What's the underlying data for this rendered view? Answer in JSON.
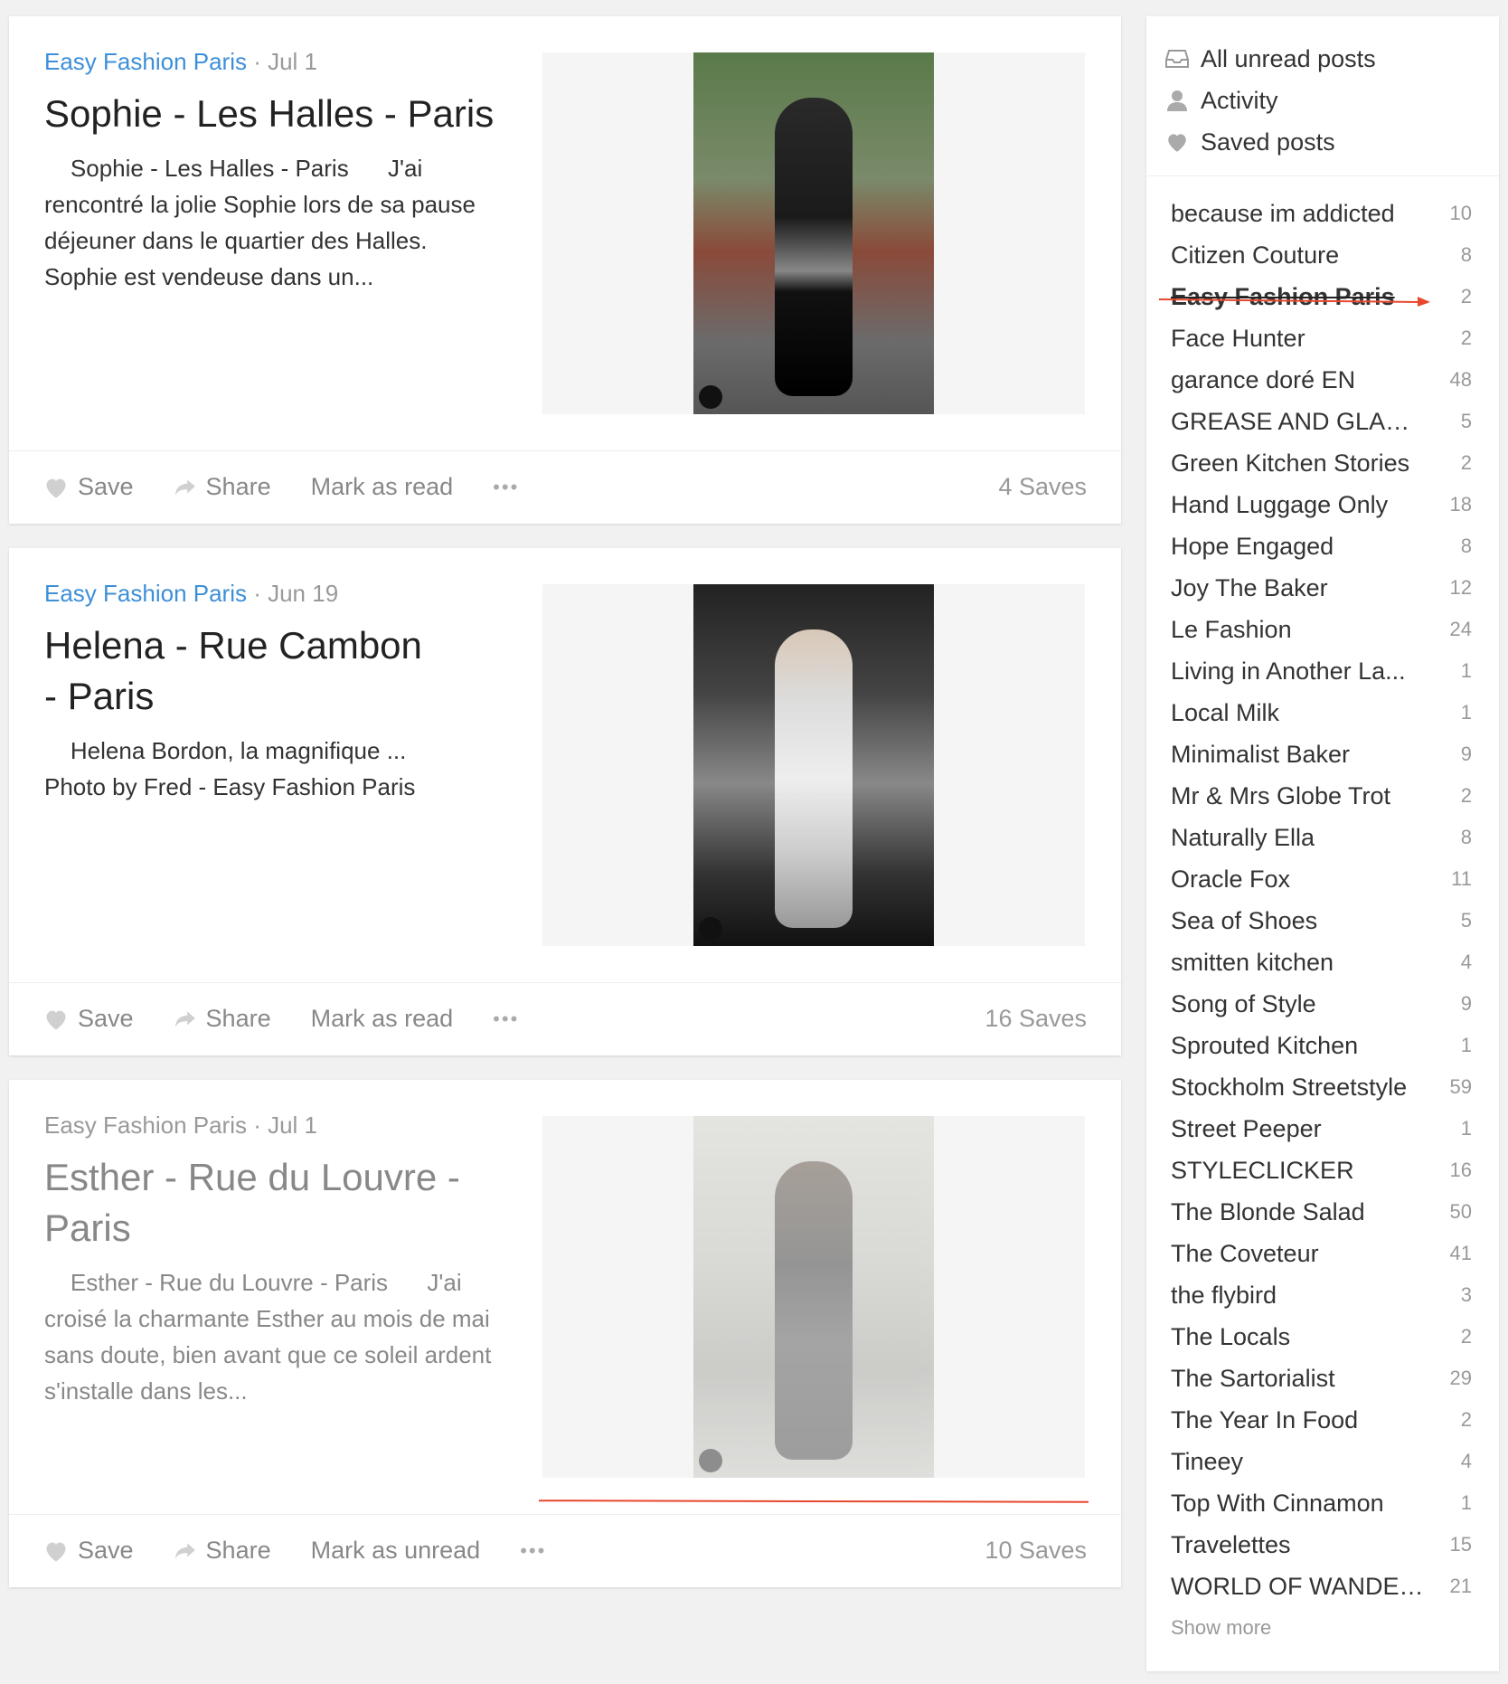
{
  "colors": {
    "accent": "#3d8fd8",
    "annotation": "#e8472e"
  },
  "posts": [
    {
      "source": "Easy Fashion Paris",
      "sep": " · ",
      "date": "Jul 1",
      "title": "Sophie - Les Halles - Paris",
      "excerpt": "    Sophie - Les Halles - Paris      J'ai rencontré la jolie Sophie lors de sa pause déjeuner dans le quartier des Halles.     Sophie est vendeuse dans un...",
      "save_label": "Save",
      "share_label": "Share",
      "mark_label": "Mark as read",
      "more_label": "•••",
      "saves": "4 Saves",
      "read": false
    },
    {
      "source": "Easy Fashion Paris",
      "sep": " · ",
      "date": "Jun 19",
      "title": "Helena - Rue Cambon - Paris",
      "excerpt": "    Helena Bordon, la magnifique ...\nPhoto by Fred - Easy Fashion Paris",
      "save_label": "Save",
      "share_label": "Share",
      "mark_label": "Mark as read",
      "more_label": "•••",
      "saves": "16 Saves",
      "read": false
    },
    {
      "source": "Easy Fashion Paris",
      "sep": " · ",
      "date": "Jul 1",
      "title": "Esther - Rue du Louvre - Paris",
      "excerpt": "    Esther - Rue du Louvre - Paris      J'ai croisé la charmante Esther au mois de mai sans doute, bien avant que ce soleil ardent s'installe dans les...",
      "save_label": "Save",
      "share_label": "Share",
      "mark_label": "Mark as unread",
      "more_label": "•••",
      "saves": "10 Saves",
      "read": true
    }
  ],
  "sidebar": {
    "top_links": [
      {
        "label": "All unread posts",
        "icon": "inbox-icon"
      },
      {
        "label": "Activity",
        "icon": "person-icon"
      },
      {
        "label": "Saved posts",
        "icon": "heart-icon"
      }
    ],
    "subscriptions": [
      {
        "name": "because im addicted",
        "count": "10"
      },
      {
        "name": "Citizen Couture",
        "count": "8"
      },
      {
        "name": "Easy Fashion Paris",
        "count": "2",
        "active": true
      },
      {
        "name": "Face Hunter",
        "count": "2"
      },
      {
        "name": "garance doré EN",
        "count": "48"
      },
      {
        "name": "GREASE AND GLAM...",
        "count": "5"
      },
      {
        "name": "Green Kitchen Stories",
        "count": "2"
      },
      {
        "name": "Hand Luggage Only",
        "count": "18"
      },
      {
        "name": "Hope Engaged",
        "count": "8"
      },
      {
        "name": "Joy The Baker",
        "count": "12"
      },
      {
        "name": "Le Fashion",
        "count": "24"
      },
      {
        "name": "Living in Another La...",
        "count": "1"
      },
      {
        "name": "Local Milk",
        "count": "1"
      },
      {
        "name": "Minimalist Baker",
        "count": "9"
      },
      {
        "name": "Mr & Mrs Globe Trot",
        "count": "2"
      },
      {
        "name": "Naturally Ella",
        "count": "8"
      },
      {
        "name": "Oracle Fox",
        "count": "11"
      },
      {
        "name": "Sea of Shoes",
        "count": "5"
      },
      {
        "name": "smitten kitchen",
        "count": "4"
      },
      {
        "name": "Song of Style",
        "count": "9"
      },
      {
        "name": "Sprouted Kitchen",
        "count": "1"
      },
      {
        "name": "Stockholm Streetstyle",
        "count": "59"
      },
      {
        "name": "Street Peeper",
        "count": "1"
      },
      {
        "name": "STYLECLICKER",
        "count": "16"
      },
      {
        "name": "The Blonde Salad",
        "count": "50"
      },
      {
        "name": "The Coveteur",
        "count": "41"
      },
      {
        "name": "the flybird",
        "count": "3"
      },
      {
        "name": "The Locals",
        "count": "2"
      },
      {
        "name": "The Sartorialist",
        "count": "29"
      },
      {
        "name": "The Year In Food",
        "count": "2"
      },
      {
        "name": "Tineey",
        "count": "4"
      },
      {
        "name": "Top With Cinnamon",
        "count": "1"
      },
      {
        "name": "Travelettes",
        "count": "15"
      },
      {
        "name": "WORLD OF WANDER...",
        "count": "21"
      }
    ],
    "show_more": "Show more"
  }
}
